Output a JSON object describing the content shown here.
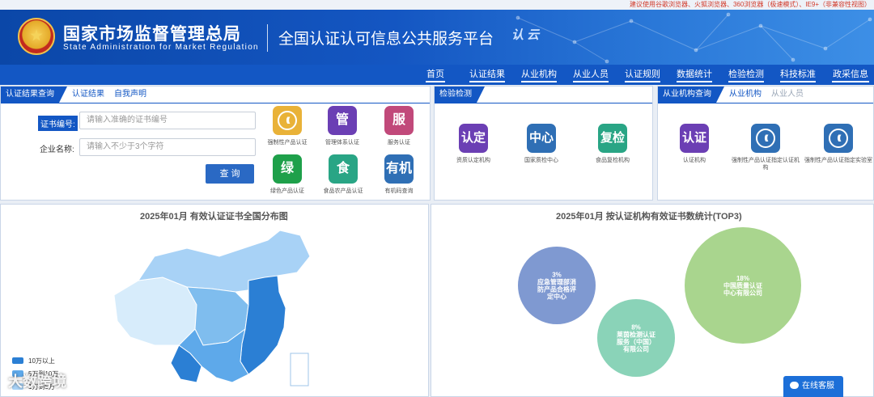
{
  "browser_tip": "建议使用谷歌浏览器、火狐浏览器、360浏览器（极速模式）、IE9+（非兼容性视图）",
  "header": {
    "org_cn": "国家市场监督管理总局",
    "org_en": "State Administration  for  Market Regulation",
    "platform": "全国认证认可信息公共服务平台",
    "logo_text": "认 云"
  },
  "nav": [
    {
      "label": "首页"
    },
    {
      "label": "认证结果"
    },
    {
      "label": "从业机构"
    },
    {
      "label": "从业人员"
    },
    {
      "label": "认证规则"
    },
    {
      "label": "数据统计"
    },
    {
      "label": "检验检测"
    },
    {
      "label": "科技标准"
    },
    {
      "label": "政采信息"
    }
  ],
  "cert_panel": {
    "tabs": [
      "认证结果查询",
      "认证结果",
      "自我声明"
    ],
    "cert_no_label": "证书编号:",
    "cert_no_placeholder": "请输入准确的证书编号",
    "company_label": "企业名称:",
    "company_placeholder": "请输入不少于3个字符",
    "query_label": "查 询",
    "tiles": [
      {
        "text": "",
        "label": "强制性产品认证",
        "color": "#e9b238"
      },
      {
        "text": "管",
        "label": "管理体系认证",
        "color": "#6b3fb4"
      },
      {
        "text": "服",
        "label": "服务认证",
        "color": "#c1497a"
      },
      {
        "text": "绿",
        "label": "绿色产品认证",
        "color": "#1ea04a"
      },
      {
        "text": "食",
        "label": "食品农产品认证",
        "color": "#29a585"
      },
      {
        "text": "有机",
        "label": "有机码查询",
        "color": "#2f6fb5"
      }
    ]
  },
  "inspect_panel": {
    "tabs": [
      "检验检测"
    ],
    "tiles": [
      {
        "text": "认定",
        "label": "资质认定机构",
        "color": "#6b3fb4"
      },
      {
        "text": "中心",
        "label": "国家质检中心",
        "color": "#2f6fb5"
      },
      {
        "text": "复检",
        "label": "食品复检机构",
        "color": "#29a585"
      }
    ]
  },
  "org_panel": {
    "tabs": [
      "从业机构查询",
      "从业机构",
      "从业人员"
    ],
    "tiles": [
      {
        "text": "认证",
        "label": "认证机构",
        "color": "#6b3fb4"
      },
      {
        "text": "",
        "label": "强制性产品认证指定认证机构",
        "color": "#2f6fb5"
      },
      {
        "text": "",
        "label": "强制性产品认证指定实验室",
        "color": "#2f6fb5"
      }
    ]
  },
  "map_panel": {
    "title": "2025年01月  有效认证证书全国分布图",
    "legend": [
      {
        "label": "10万以上",
        "color": "#2b7fd4"
      },
      {
        "label": "5万到10万",
        "color": "#5ea9ea"
      },
      {
        "label": "1万到5万",
        "color": "#a8d2f6"
      }
    ]
  },
  "bubble_panel": {
    "title": "2025年01月   按认证机构有效证书数统计(TOP3)"
  },
  "chart_data": {
    "type": "bubble",
    "title": "2025年01月   按认证机构有效证书数统计(TOP3)",
    "series": [
      {
        "name": "中国质量认证中心有限公司",
        "value_pct": 18,
        "pct_label": "18%",
        "label": "中国质量认证\n中心有限公司",
        "color": "#a9d58e"
      },
      {
        "name": "应急管理部消防产品合格评定中心",
        "value_pct": 3,
        "pct_label": "3%",
        "label": "应急管理部消\n防产品合格评\n定中心",
        "color": "#7f99d1"
      },
      {
        "name": "莱茵检测认证服务（中国）有限公司",
        "value_pct": 8,
        "pct_label": "8%",
        "label": "莱茵检测认证\n服务（中国）\n有限公司",
        "color": "#8ad3b8"
      }
    ]
  },
  "service_button": "在线客服",
  "watermark": "大数跨境"
}
